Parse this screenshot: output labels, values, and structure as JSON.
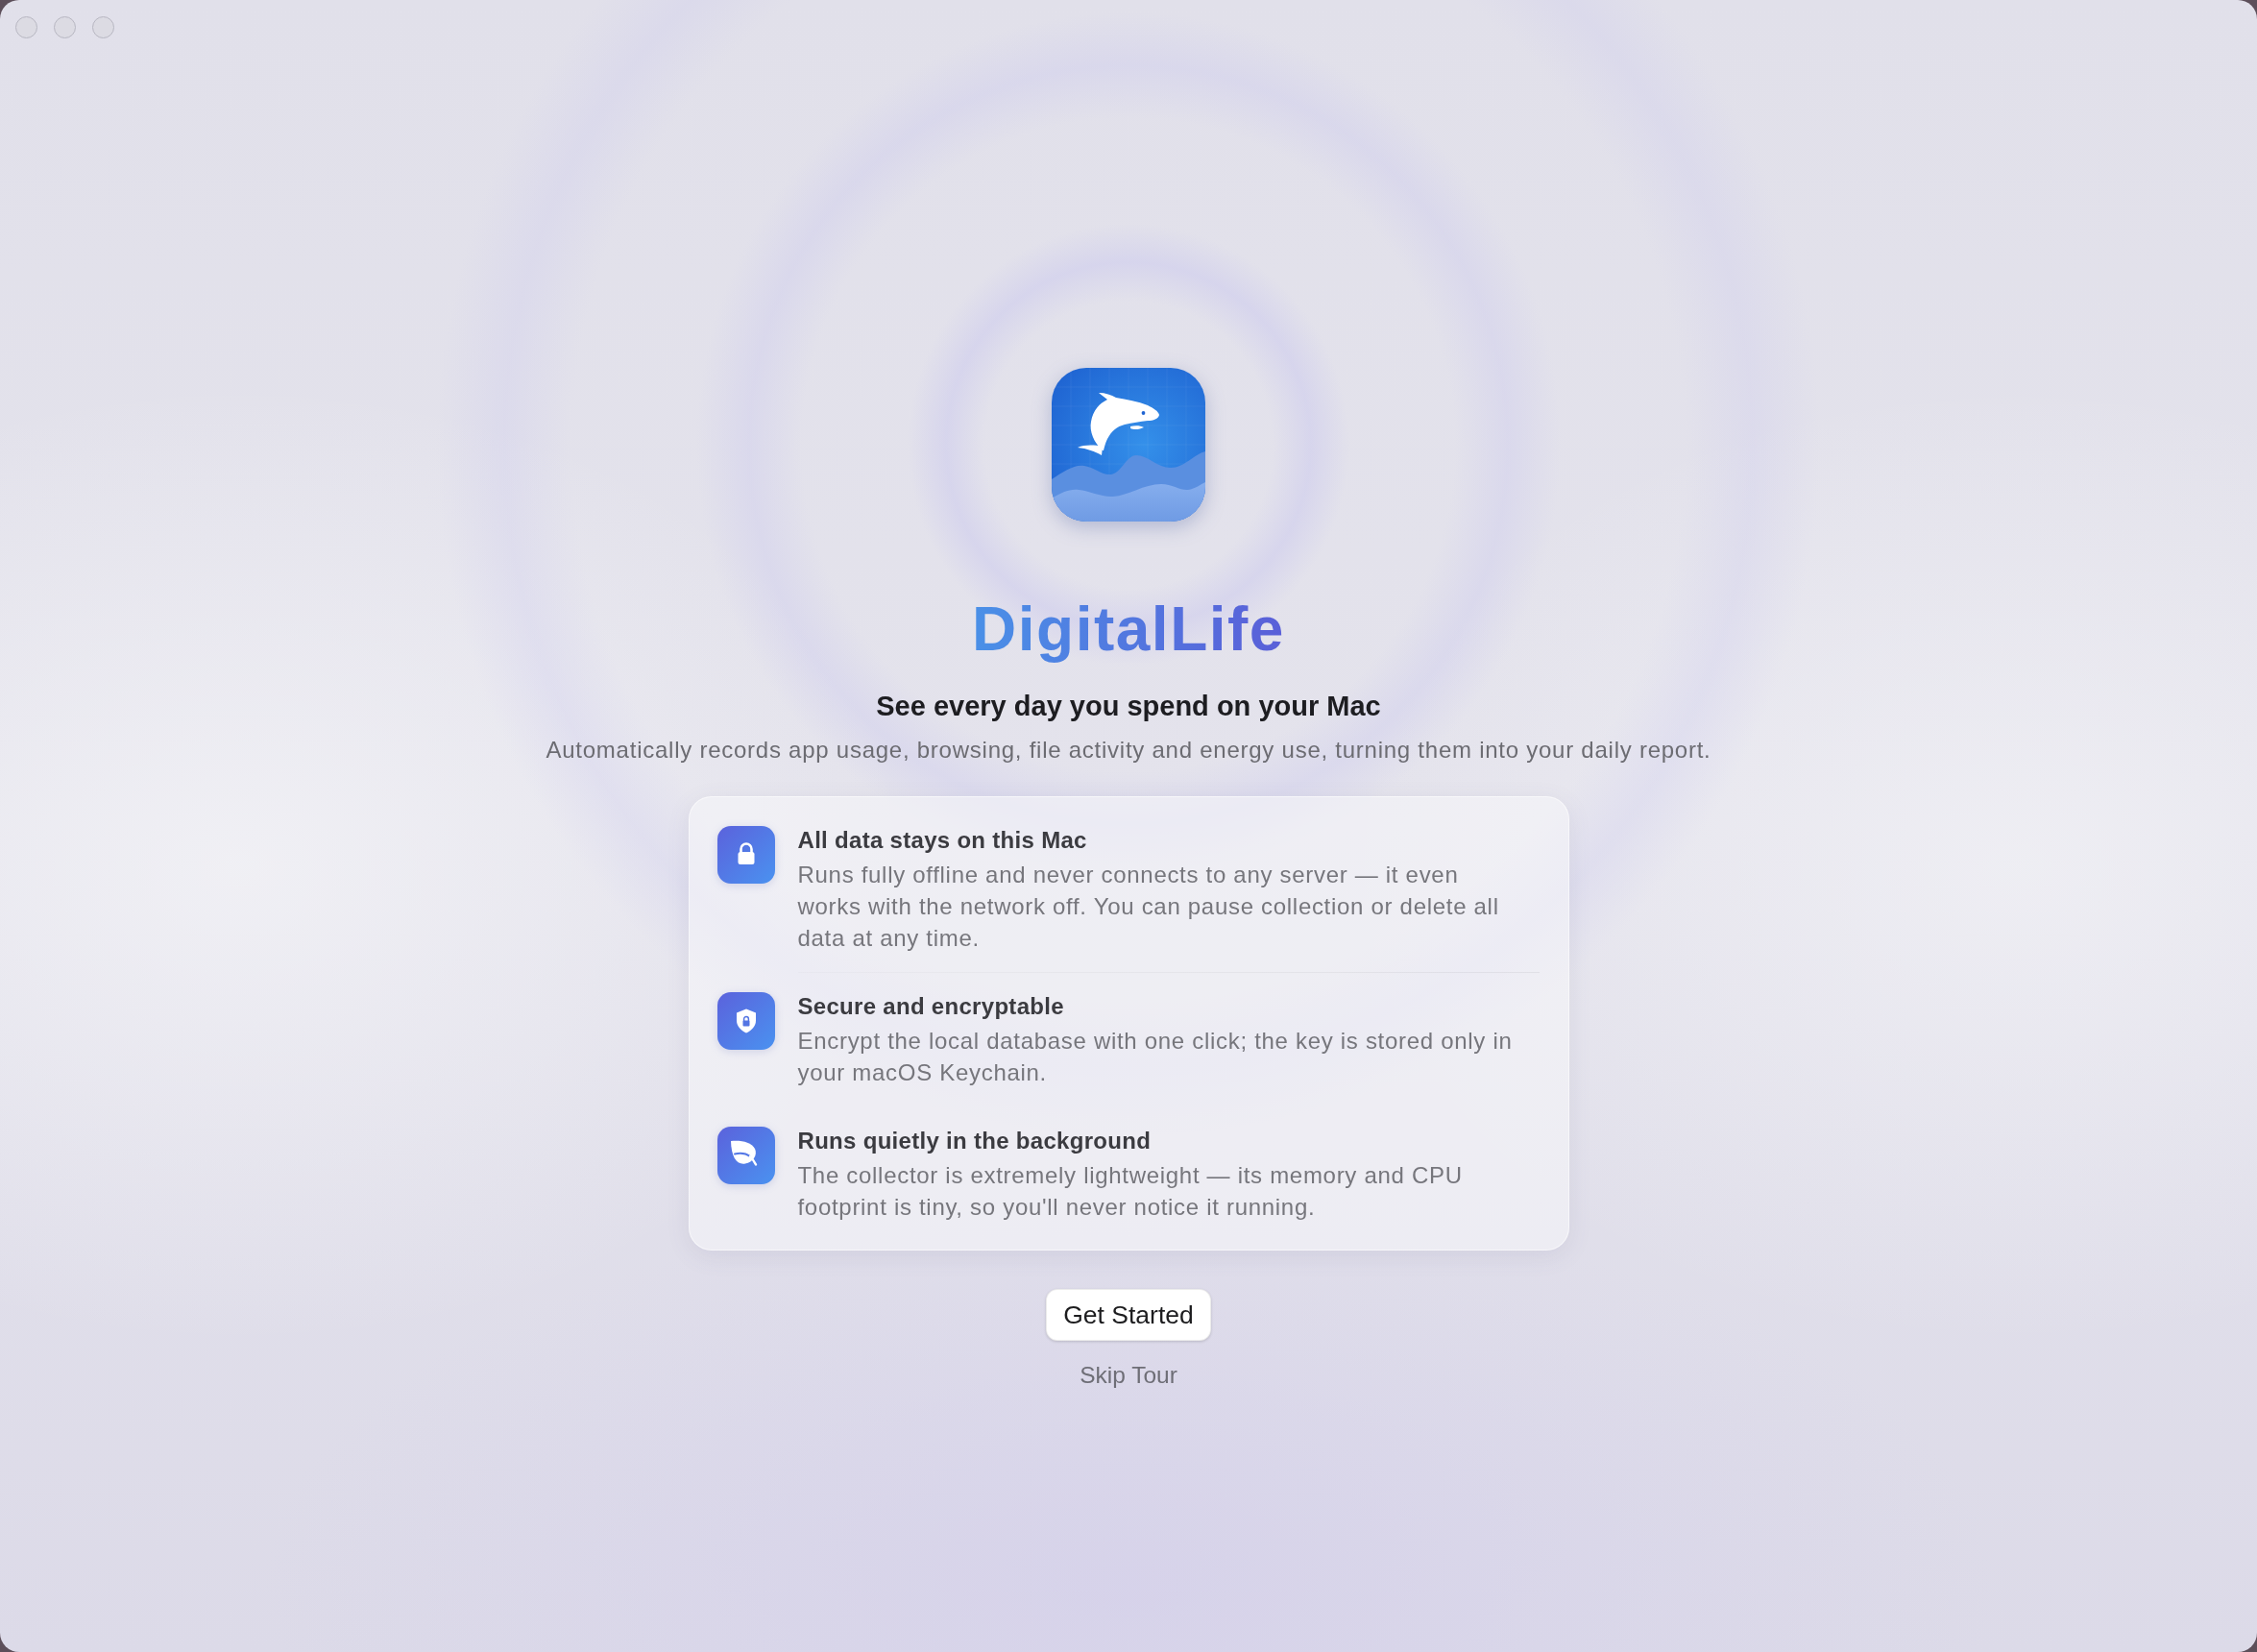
{
  "app": {
    "name": "DigitalLife",
    "tagline": "See every day you spend on your Mac",
    "description": "Automatically records app usage, browsing, file activity and energy use, turning them into your daily report."
  },
  "features": [
    {
      "title": "All data stays on this Mac",
      "text": "Runs fully offline and never connects to any server — it even works with the network off. You can pause collection or delete all data at any time."
    },
    {
      "title": "Secure and encryptable",
      "text": "Encrypt the local database with one click; the key is stored only in your macOS Keychain."
    },
    {
      "title": "Runs quietly in the background",
      "text": "The collector is extremely lightweight — its memory and CPU footprint is tiny, so you'll never notice it running."
    }
  ],
  "actions": [
    {
      "kind": "button",
      "label": "Get Started"
    },
    {
      "kind": "link",
      "label": "Skip Tour"
    }
  ]
}
